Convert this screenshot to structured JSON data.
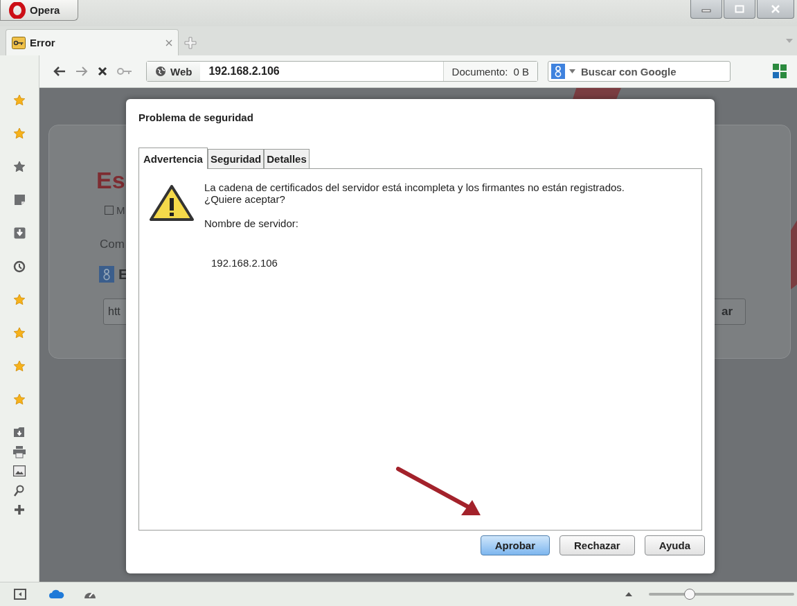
{
  "title_bar": {
    "menu_button": "Opera"
  },
  "tabs": [
    {
      "label": "Error",
      "selected": true
    }
  ],
  "toolbar": {
    "scheme_label": "Web",
    "url": "192.168.2.106",
    "document_label": "Documento:",
    "document_size": "0 B",
    "search": {
      "placeholder": "Buscar con Google"
    }
  },
  "background_page": {
    "heading": "Es",
    "checkbox_label": "M",
    "checked": false,
    "text": "Com",
    "search_label": "E",
    "input_value": "htt",
    "button_label": "ar"
  },
  "dialog": {
    "title": "Problema de seguridad",
    "tabs": [
      {
        "label": "Advertencia",
        "selected": true
      },
      {
        "label": "Seguridad",
        "selected": false
      },
      {
        "label": "Detalles",
        "selected": false
      }
    ],
    "message": "La cadena de certificados del servidor está incompleta y los firmantes no están registrados.",
    "question": "¿Quiere aceptar?",
    "server_label": "Nombre de servidor:",
    "server_name": "192.168.2.106",
    "buttons": [
      {
        "label": "Aprobar",
        "default": true
      },
      {
        "label": "Rechazar",
        "default": false
      },
      {
        "label": "Ayuda",
        "default": false
      }
    ]
  },
  "status_bar": {
    "zoom_slider": {
      "level": 0.28
    }
  }
}
